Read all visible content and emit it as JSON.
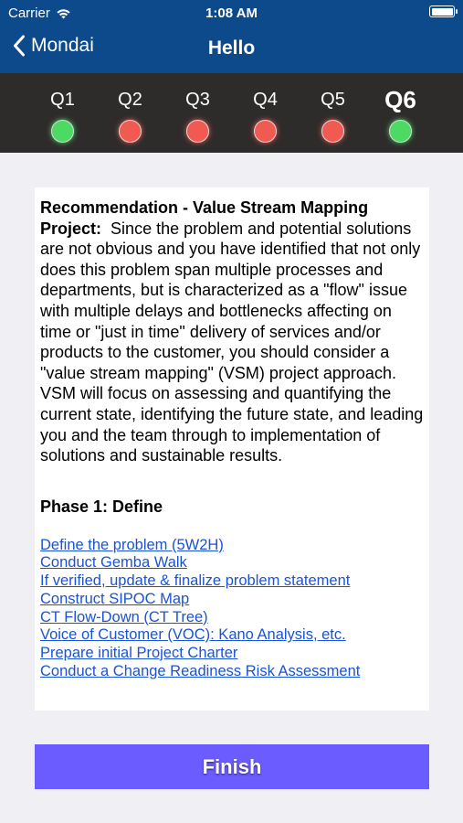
{
  "status_bar": {
    "carrier": "Carrier",
    "time": "1:08 AM"
  },
  "nav": {
    "back_label": "Mondai",
    "title": "Hello"
  },
  "questions": [
    {
      "label": "Q1",
      "status_color": "#4cd964",
      "active": false
    },
    {
      "label": "Q2",
      "status_color": "#f05a50",
      "active": false
    },
    {
      "label": "Q3",
      "status_color": "#f05a50",
      "active": false
    },
    {
      "label": "Q4",
      "status_color": "#f05a50",
      "active": false
    },
    {
      "label": "Q5",
      "status_color": "#f05a50",
      "active": false
    },
    {
      "label": "Q6",
      "status_color": "#4cd964",
      "active": true
    }
  ],
  "recommendation": {
    "heading": "Recommendation - Value Stream Mapping Project:",
    "body": "Since the problem and potential solutions are not obvious and you have identified that not only does this problem span multiple processes and departments, but is characterized as a \"flow\" issue with multiple delays and bottlenecks affecting on time or \"just in time\" delivery of services and/or products to the customer, you should consider a \"value stream mapping\" (VSM) project approach.  VSM will focus on assessing and quantifying the current state, identifying the future state, and leading you and the team through to implementation of solutions and sustainable results."
  },
  "phase": {
    "title": "Phase 1: Define",
    "links": [
      "Define the problem (5W2H)",
      "Conduct Gemba Walk",
      "If verified, update & finalize problem statement",
      "Construct SIPOC Map",
      "CT Flow-Down (CT Tree)",
      "Voice of Customer (VOC): Kano Analysis, etc.",
      "Prepare initial Project Charter",
      "Conduct a Change Readiness Risk Assessment"
    ]
  },
  "finish_label": "Finish",
  "colors": {
    "header_bg": "#0d4a8c",
    "strip_bg": "#2e2c2b",
    "finish_bg": "#6a5cff",
    "link": "#1a53d6"
  }
}
